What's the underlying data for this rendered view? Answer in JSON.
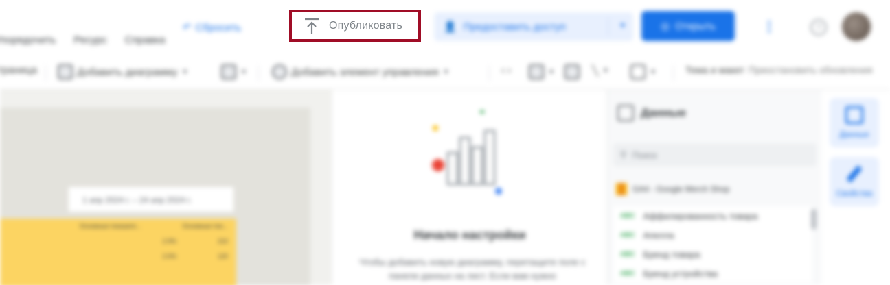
{
  "header": {
    "reset_label": "Сбросить",
    "publish_label": "Опубликовать",
    "share_label": "Предоставить доступ",
    "open_label": "Открыть"
  },
  "menu": [
    "Упорядочить",
    "Ресурс",
    "Справка"
  ],
  "toolbar": {
    "left_fragment": "Страница",
    "add_chart": "Добавить диаграмму",
    "add_control": "Добавить элемент управления",
    "theme_layout": "Тема и макет",
    "pause_updates": "Приостановить обновления"
  },
  "canvas": {
    "date_range": "1 апр 2024 г. – 24 апр 2024 г.",
    "table_headers": [
      "Основные показате...",
      "Основные пок..."
    ],
    "table_rows": [
      [
        "2.9%",
        "210"
      ],
      [
        "2.6%",
        "120"
      ]
    ]
  },
  "middle": {
    "title": "Начало настройки",
    "text": "Чтобы добавить новую диаграмму, перетащите поле с панели данных на лист. Если вам нужно"
  },
  "data_panel": {
    "title": "Данные",
    "search_placeholder": "Поиск",
    "source_name": "GA4 - Google Merch Shop",
    "fields": [
      "Аффилированность товара",
      "Апелла",
      "Бренд товара",
      "Бренд устройства"
    ]
  },
  "rail": {
    "data_label": "Данные",
    "properties_label": "Свойства"
  },
  "colors": {
    "highlight_border": "#a00d26",
    "primary": "#1a73e8",
    "table_bg": "#fcd462"
  },
  "icons": {
    "publish": "upload-arrow-icon",
    "reset": "undo-icon",
    "share": "add-person-icon",
    "open": "eye-icon",
    "more": "vertical-dots-icon",
    "help": "help-circle-icon"
  }
}
